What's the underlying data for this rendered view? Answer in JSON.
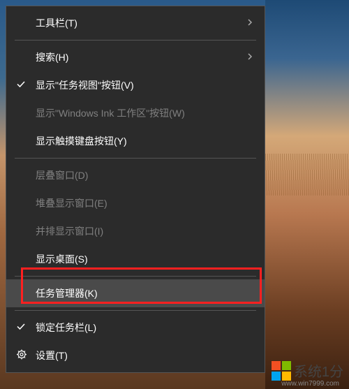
{
  "menu": {
    "items": [
      {
        "label": "工具栏(T)",
        "submenu": true
      },
      {
        "label": "搜索(H)",
        "submenu": true,
        "sepBefore": true
      },
      {
        "label": "显示\"任务视图\"按钮(V)",
        "checked": true
      },
      {
        "label": "显示\"Windows Ink 工作区\"按钮(W)",
        "disabled": true
      },
      {
        "label": "显示触摸键盘按钮(Y)"
      },
      {
        "label": "层叠窗口(D)",
        "disabled": true,
        "sepBefore": true
      },
      {
        "label": "堆叠显示窗口(E)",
        "disabled": true
      },
      {
        "label": "并排显示窗口(I)",
        "disabled": true
      },
      {
        "label": "显示桌面(S)"
      },
      {
        "label": "任务管理器(K)",
        "hovered": true,
        "sepBefore": true,
        "highlighted": true
      },
      {
        "label": "锁定任务栏(L)",
        "checked": true,
        "sepBefore": true
      },
      {
        "label": "设置(T)",
        "gear": true
      }
    ]
  },
  "watermark": {
    "brand": "系统1分",
    "url": "www.win7999.com"
  }
}
